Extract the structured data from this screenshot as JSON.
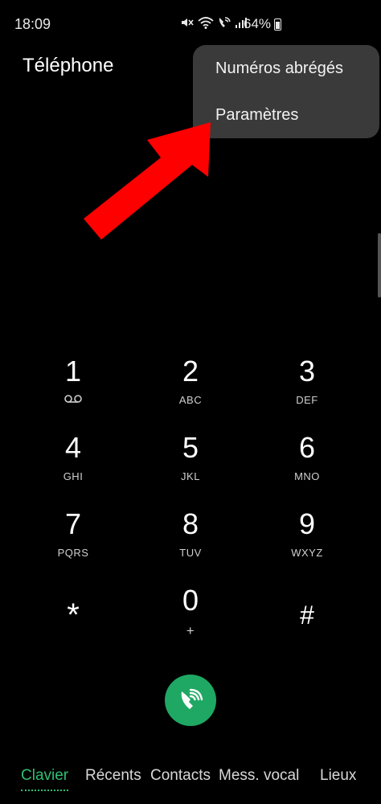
{
  "status_bar": {
    "time": "18:09",
    "battery": "64%",
    "icons": [
      "mute-icon",
      "wifi-icon",
      "wifi-call-icon",
      "signal-icon",
      "battery-icon"
    ]
  },
  "app": {
    "title": "Téléphone"
  },
  "menu": {
    "items": [
      {
        "label": "Numéros abrégés"
      },
      {
        "label": "Paramètres"
      }
    ]
  },
  "annotation": {
    "arrow_color": "#ff0000"
  },
  "keypad": {
    "keys": [
      {
        "digit": "1",
        "sub": ""
      },
      {
        "digit": "2",
        "sub": "ABC"
      },
      {
        "digit": "3",
        "sub": "DEF"
      },
      {
        "digit": "4",
        "sub": "GHI"
      },
      {
        "digit": "5",
        "sub": "JKL"
      },
      {
        "digit": "6",
        "sub": "MNO"
      },
      {
        "digit": "7",
        "sub": "PQRS"
      },
      {
        "digit": "8",
        "sub": "TUV"
      },
      {
        "digit": "9",
        "sub": "WXYZ"
      },
      {
        "digit": "*",
        "sub": ""
      },
      {
        "digit": "0",
        "sub": "+"
      },
      {
        "digit": "#",
        "sub": ""
      }
    ]
  },
  "call_button": {
    "icon": "wifi-call-icon",
    "color": "#1fa863"
  },
  "tabs": [
    {
      "label": "Clavier",
      "active": true
    },
    {
      "label": "Récents"
    },
    {
      "label": "Contacts"
    },
    {
      "label": "Mess. vocal"
    },
    {
      "label": "Lieux"
    }
  ],
  "colors": {
    "accent": "#2fbf71",
    "menu_bg": "#3a3a3a"
  }
}
